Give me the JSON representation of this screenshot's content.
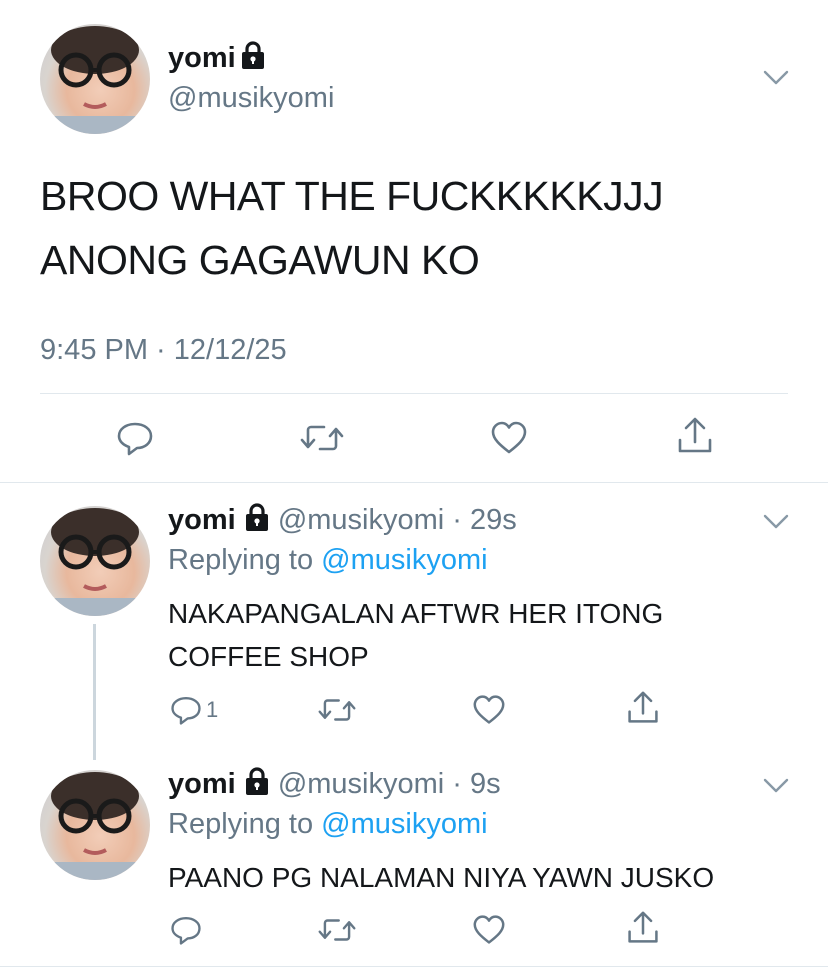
{
  "main_tweet": {
    "display_name": "yomi",
    "handle": "@musikyomi",
    "text_line1": "BROO WHAT THE FUCKKKKKJJJ",
    "text_line2": "ANONG GAGAWUN KO",
    "timestamp": "9:45 PM · 12/12/25",
    "icons": [
      "lock-icon",
      "chevron-down-icon",
      "reply-icon",
      "retweet-icon",
      "like-icon",
      "share-icon"
    ]
  },
  "replies": [
    {
      "display_name": "yomi",
      "handle_time": "@musikyomi · 29s",
      "replying_prefix": "Replying to",
      "replying_handle": "@musikyomi",
      "text_line1": "NAKAPANGALAN AFTWR HER ITONG",
      "text_line2": "COFFEE SHOP",
      "reply_count": "1"
    },
    {
      "display_name": "yomi",
      "handle_time": "@musikyomi · 9s",
      "replying_prefix": "Replying to",
      "replying_handle": "@musikyomi",
      "text_line1": "PAANO PG NALAMAN NIYA YAWN JUSKO"
    }
  ],
  "colors": {
    "text": "#14171a",
    "secondary": "#657786",
    "link": "#1da1f2",
    "divider": "#e1e8ed",
    "thread_line": "#ccd6dd"
  }
}
